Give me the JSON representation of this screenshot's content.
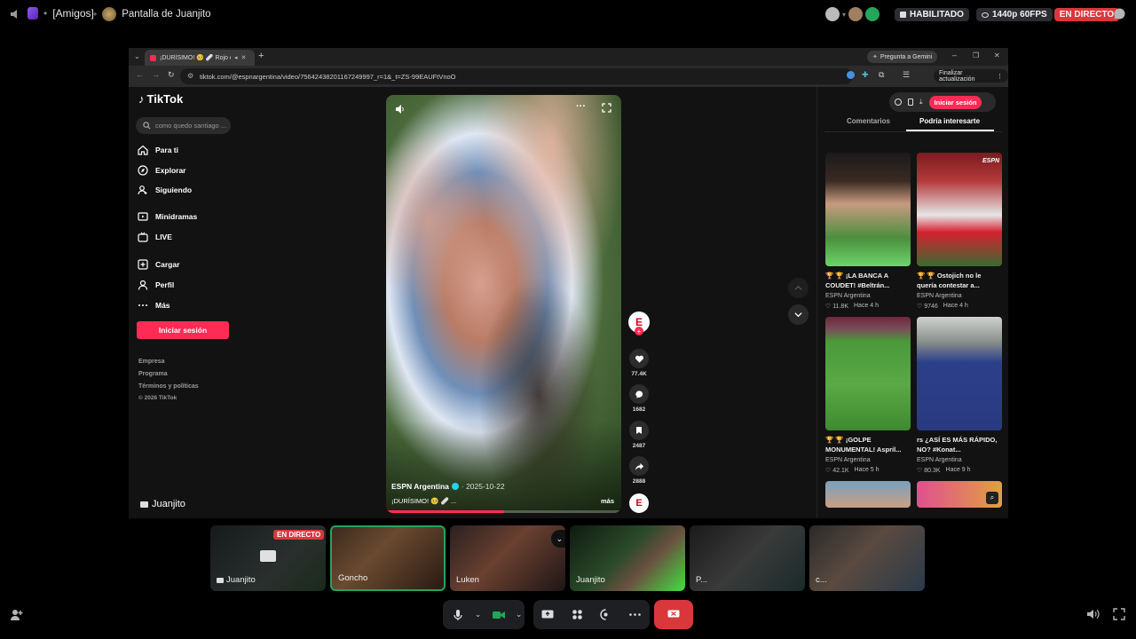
{
  "topbar": {
    "server_label": "[Amigos]",
    "stream_title": "Pantalla de Juanjito",
    "status_enabled": "HABILITADO",
    "quality": "1440p 60FPS",
    "live_label": "EN DIRECTO"
  },
  "browser": {
    "tab_title": "¡DURÍSIMO! 🥺 🩹 Rojo ch",
    "gemini_label": "Pregunta a Gemini",
    "url": "tiktok.com/@espnargentina/video/75642438201167249997_r=1&_t=ZS-99EAUFtVnoO",
    "update_label": "Finalizar actualización"
  },
  "tiktok": {
    "logo": "TikTok",
    "search_placeholder": "como quedo santiago ...",
    "nav": [
      "Para ti",
      "Explorar",
      "Siguiendo",
      "Minidramas",
      "LIVE",
      "Cargar",
      "Perfil",
      "Más"
    ],
    "login": "Iniciar sesión",
    "footer": [
      "Empresa",
      "Programa",
      "Términos y políticas",
      "© 2026 TikTok"
    ],
    "video": {
      "author": "ESPN Argentina",
      "date": "· 2025-10-22",
      "caption": "¡DURÍSIMO! 🥺 🩹 ...",
      "more": "más",
      "progress": 0.5,
      "likes": "77.4K",
      "comments": "1682",
      "saves": "2487",
      "shares": "2888"
    },
    "right": {
      "login": "Iniciar sesión",
      "tabs": [
        "Comentarios",
        "Podría interesarte"
      ],
      "items": [
        {
          "caption": "🏆 🏆 ¡LA BANCA A COUDET! #Beltrán...",
          "author": "ESPN Argentina",
          "likes": "♡ 11.8K",
          "time": "Hace 4 h"
        },
        {
          "caption": "🏆 🏆 Ostojich no le quería contestar a...",
          "author": "ESPN Argentina",
          "likes": "♡ 9746",
          "time": "Hace 4 h"
        },
        {
          "caption": "🏆 🏆 ¡GOLPE MONUMENTAL! Aspril...",
          "author": "ESPN Argentina",
          "likes": "♡ 42.1K",
          "time": "Hace 5 h"
        },
        {
          "caption": "rs ¿ASÍ ES MÁS RÁPIDO, NO? #Konat...",
          "author": "ESPN Argentina",
          "likes": "♡ 80.3K",
          "time": "Hace 9 h"
        }
      ]
    }
  },
  "stream_owner": "Juanjito",
  "participants": [
    {
      "name": "Juanjito",
      "badge": "EN DIRECTO"
    },
    {
      "name": "Goncho"
    },
    {
      "name": "Luken"
    },
    {
      "name": "Juanjito"
    },
    {
      "name": "P..."
    },
    {
      "name": "c..."
    }
  ],
  "colors": {
    "accent_red": "#fe2c55",
    "discord_live": "#da373c",
    "discord_bg": "#000000",
    "hangup": "#da373c"
  }
}
